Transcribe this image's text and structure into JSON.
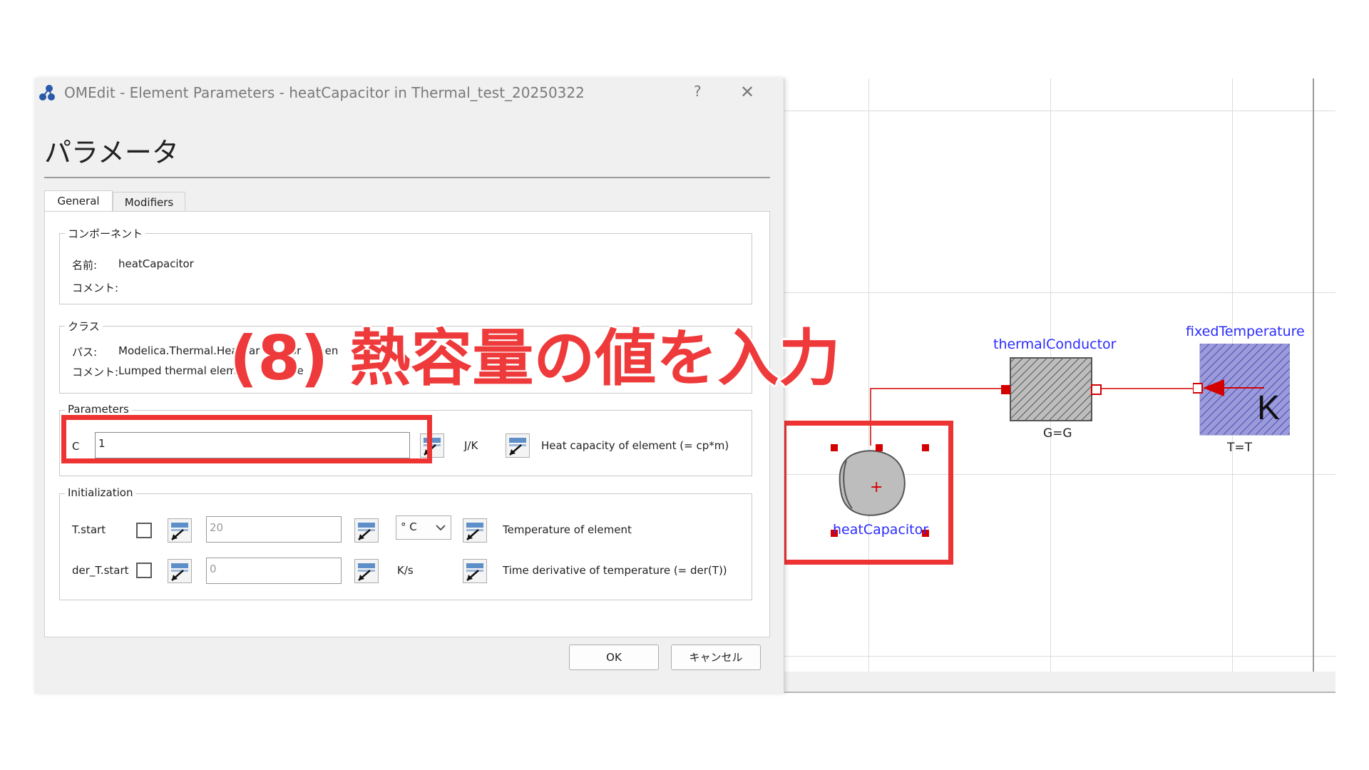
{
  "dialog": {
    "title": "OMEdit - Element Parameters - heatCapacitor in Thermal_test_20250322",
    "help": "?",
    "close": "✕",
    "heading": "パラメータ",
    "tabs": [
      {
        "label": "General",
        "active": true
      },
      {
        "label": "Modifiers",
        "active": false
      }
    ],
    "component": {
      "title": "コンポーネント",
      "name_label": "名前:",
      "name_value": "heatCapacitor",
      "comment_label": "コメント:",
      "comment_value": ""
    },
    "class": {
      "title": "クラス",
      "path_label": "パス:",
      "path_value": "Modelica.Thermal.Heat",
      "path_frag1": "ar",
      "path_frag2": "or",
      "path_frag3": "onen",
      "path_frag4": "a",
      "comment_label": "コメント:",
      "comment_value": "Lumped thermal elem",
      "comment_frag1": ": s",
      "comment_frag2": "he"
    },
    "parameters": {
      "title": "Parameters",
      "c_label": "C",
      "c_value": "1",
      "c_unit": "J/K",
      "c_desc": "Heat capacity of element (= cp*m)"
    },
    "initialization": {
      "title": "Initialization",
      "rows": [
        {
          "label": "T.start",
          "value": "20",
          "unit": "° C",
          "desc": "Temperature of element"
        },
        {
          "label": "der_T.start",
          "value": "0",
          "unit": "K/s",
          "desc": "Time derivative of temperature (= der(T))"
        }
      ]
    },
    "buttons": {
      "ok": "OK",
      "cancel": "キャンセル"
    }
  },
  "annotation": "(8) 熱容量の値を入力",
  "diagram": {
    "heatCapacitor": {
      "label": "heatCapacitor"
    },
    "thermalConductor": {
      "label": "thermalConductor",
      "param": "G=G"
    },
    "fixedTemperature": {
      "label": "fixedTemperature",
      "param": "T=T",
      "symbol": "K"
    }
  },
  "colors": {
    "highlight": "#ee3333",
    "component_label": "#2b2bff",
    "connection": "#d40000",
    "fixed_temp_fill": "#9b9bdc"
  }
}
